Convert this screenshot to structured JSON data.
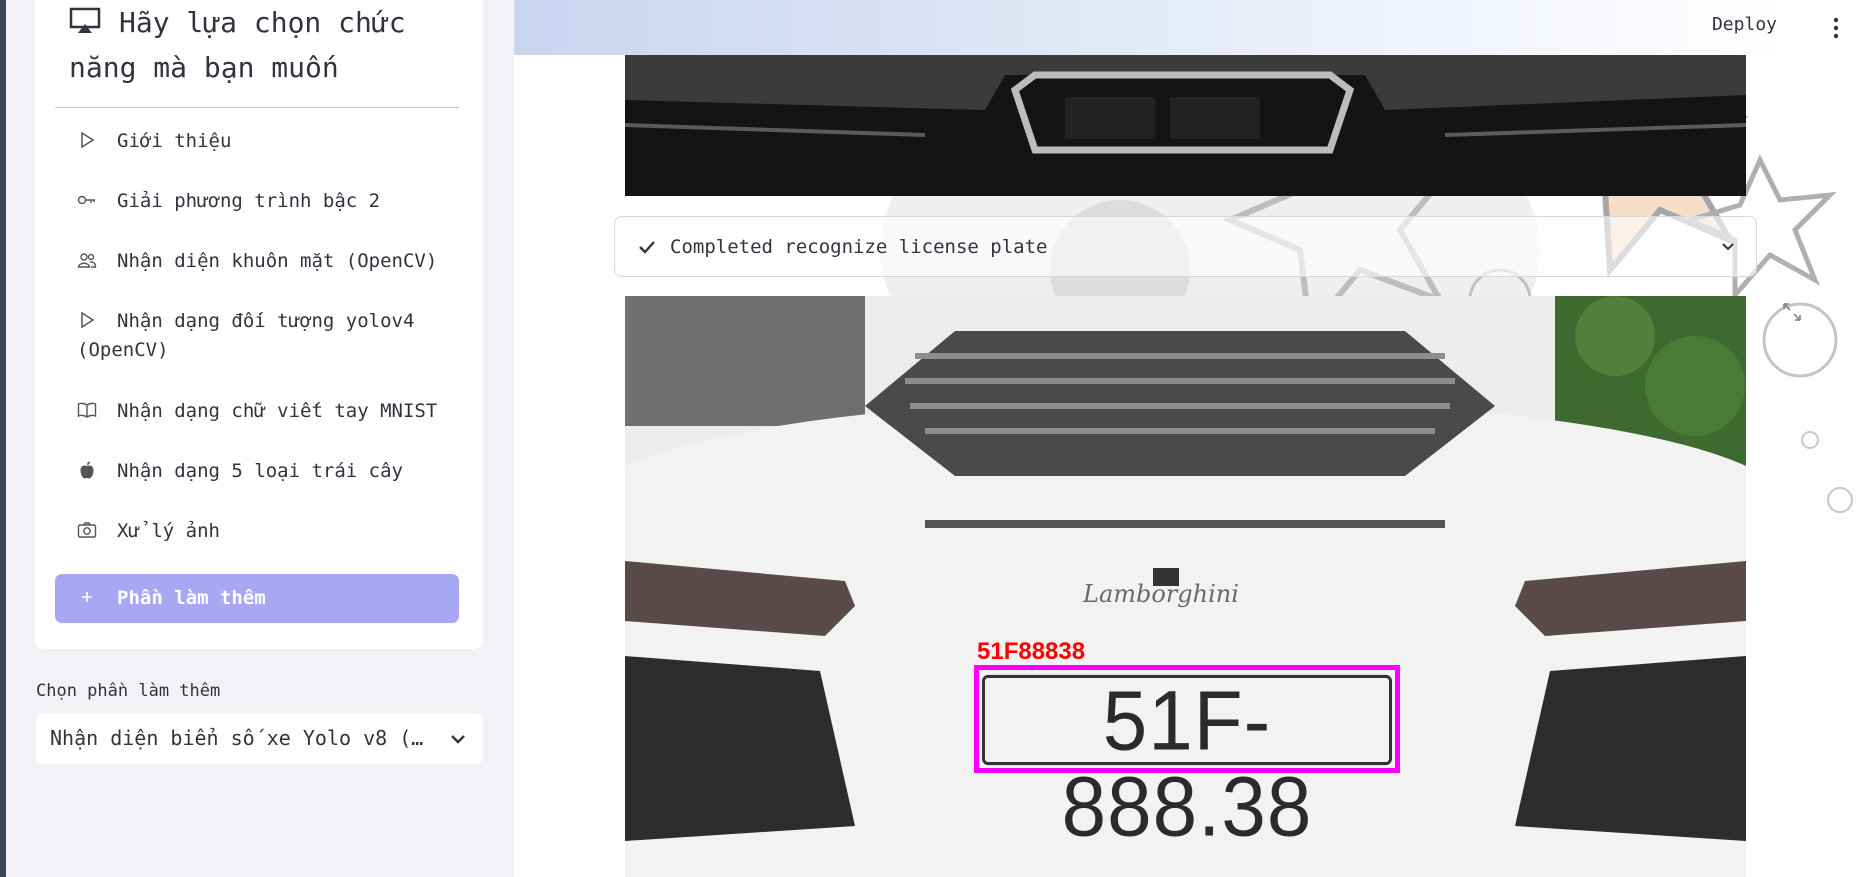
{
  "sidebar": {
    "title": "Hãy lựa chọn chức năng mà bạn muốn",
    "items": [
      {
        "label": "Giới thiệu",
        "icon": "play-icon"
      },
      {
        "label": "Giải phương trình bậc 2",
        "icon": "key-icon"
      },
      {
        "label": "Nhận diện khuôn mặt (OpenCV)",
        "icon": "people-icon"
      },
      {
        "label": "Nhận dạng đối tượng yolov4 (OpenCV)",
        "icon": "play-icon"
      },
      {
        "label": "Nhận dạng chữ viết tay MNIST",
        "icon": "book-icon"
      },
      {
        "label": "Nhận dạng 5 loại trái cây",
        "icon": "apple-icon"
      },
      {
        "label": "Xử lý ảnh",
        "icon": "camera-icon"
      },
      {
        "label": "Phần làm thêm",
        "icon": "plus-icon",
        "active": true
      }
    ],
    "extra_label": "Chọn phần làm thêm",
    "extra_value": "Nhận diện biển số xe Yolo v8 (…"
  },
  "header": {
    "deploy": "Deploy"
  },
  "status": {
    "text": "Completed recognize license plate"
  },
  "detection": {
    "label": "51F88838",
    "plate": "51F-888.38",
    "badge": "Lamborghini"
  },
  "colors": {
    "accent": "#a7a7f4",
    "box": "#ff00ff",
    "label": "#ff0000"
  }
}
